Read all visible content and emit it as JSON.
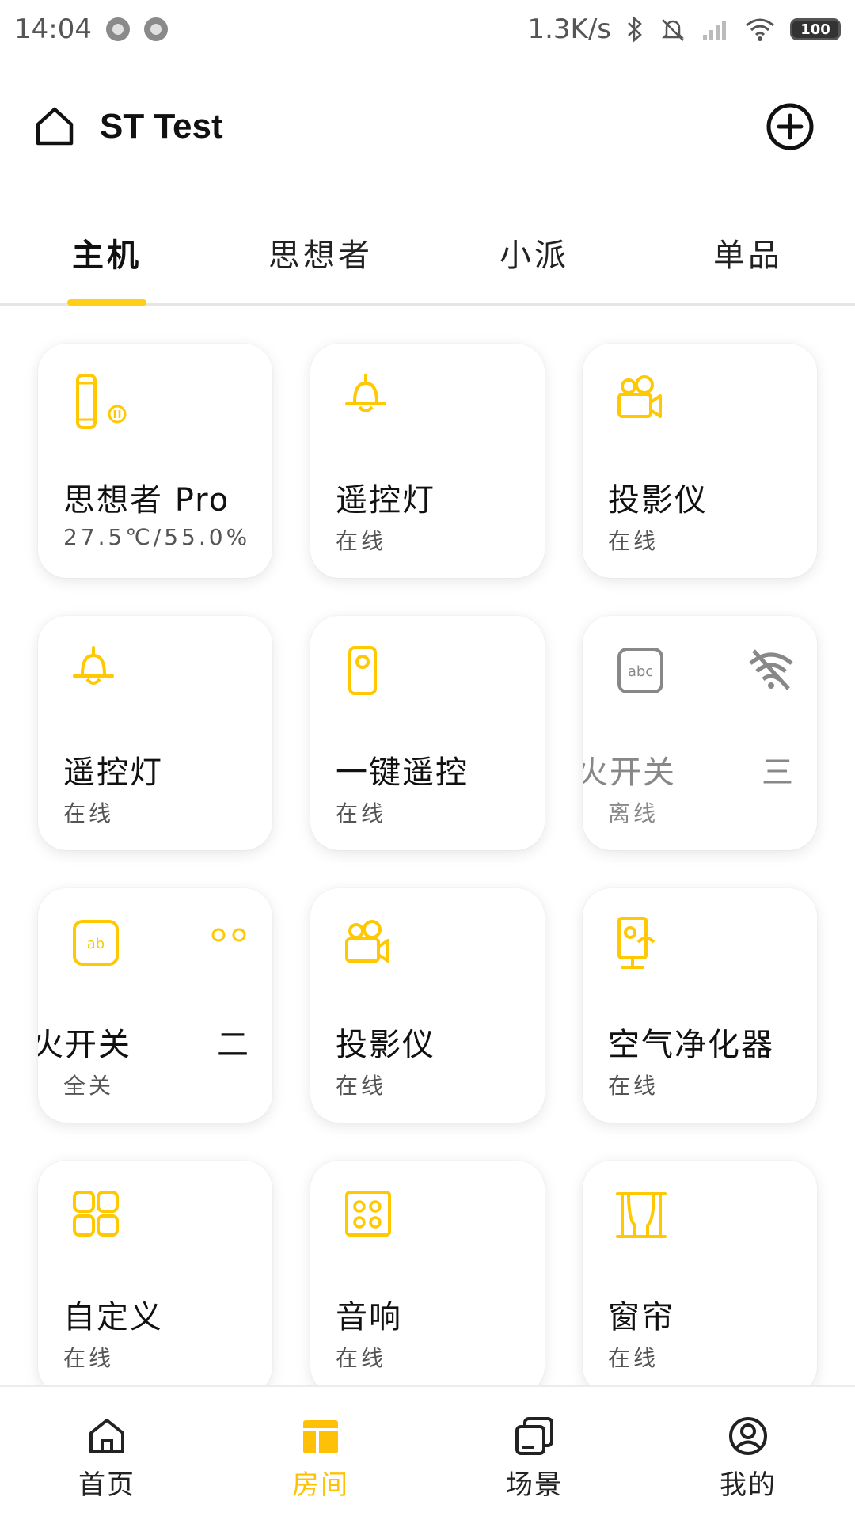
{
  "status_bar": {
    "time": "14:04",
    "net_speed": "1.3K/s",
    "battery": "100"
  },
  "header": {
    "title": "ST Test"
  },
  "tabs": [
    {
      "label": "主机",
      "active": true
    },
    {
      "label": "思想者",
      "active": false
    },
    {
      "label": "小派",
      "active": false
    },
    {
      "label": "单品",
      "active": false
    }
  ],
  "devices": [
    {
      "name": "思想者 Pro",
      "status": "27.5℃/55.0%",
      "icon": "speaker-icon",
      "offline": false
    },
    {
      "name": "遥控灯",
      "status": "在线",
      "icon": "lamp-icon",
      "offline": false
    },
    {
      "name": "投影仪",
      "status": "在线",
      "icon": "projector-icon",
      "offline": false
    },
    {
      "name": "遥控灯",
      "status": "在线",
      "icon": "lamp-icon",
      "offline": false
    },
    {
      "name": "一键遥控",
      "status": "在线",
      "icon": "remote-icon",
      "offline": false
    },
    {
      "name": "火开关",
      "name_right": "三",
      "status": "离线",
      "icon": "switch-abc-icon",
      "offline": true
    },
    {
      "name": "火开关",
      "name_right": "二",
      "status": "全关",
      "icon": "switch-ab-icon",
      "offline": false
    },
    {
      "name": "投影仪",
      "status": "在线",
      "icon": "projector-icon",
      "offline": false
    },
    {
      "name": "空气净化器",
      "status": "在线",
      "icon": "air-purifier-icon",
      "offline": false
    },
    {
      "name": "自定义",
      "status": "在线",
      "icon": "custom-grid-icon",
      "offline": false
    },
    {
      "name": "音响",
      "status": "在线",
      "icon": "audio-icon",
      "offline": false
    },
    {
      "name": "窗帘",
      "status": "在线",
      "icon": "curtain-icon",
      "offline": false
    }
  ],
  "bottom_nav": [
    {
      "label": "首页",
      "icon": "home-icon",
      "active": false
    },
    {
      "label": "房间",
      "icon": "room-icon",
      "active": true
    },
    {
      "label": "场景",
      "icon": "scene-icon",
      "active": false
    },
    {
      "label": "我的",
      "icon": "profile-icon",
      "active": false
    }
  ],
  "colors": {
    "accent": "#ffcf17",
    "icon_yellow": "#ffc800",
    "offline_gray": "#888888"
  }
}
